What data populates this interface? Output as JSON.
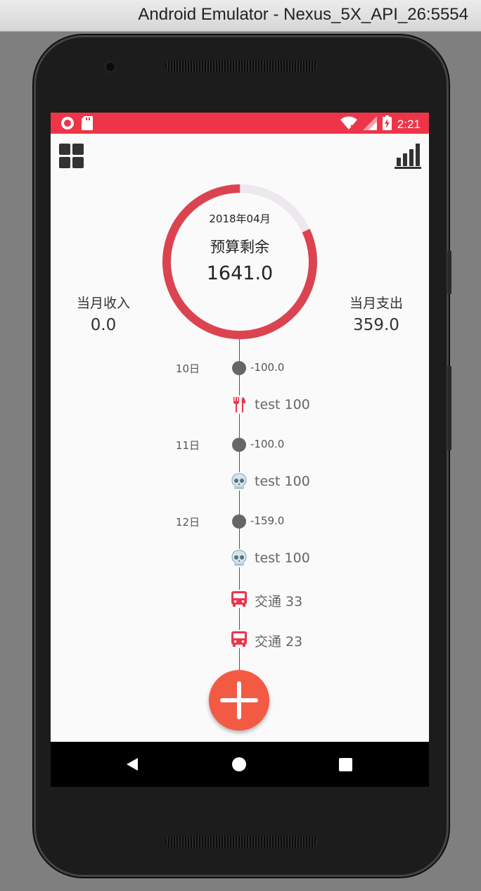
{
  "window": {
    "title": "Android Emulator - Nexus_5X_API_26:5554"
  },
  "status_bar": {
    "time": "2:21"
  },
  "app_bar": {
    "left_icon": "grid-icon",
    "right_icon": "bar-chart-icon"
  },
  "budget": {
    "month": "2018年04月",
    "label": "预算剩余",
    "value": "1641.0",
    "progress": 0.82
  },
  "income": {
    "label": "当月收入",
    "value": "0.0"
  },
  "expense": {
    "label": "当月支出",
    "value": "359.0"
  },
  "timeline": [
    {
      "type": "day",
      "day": "10日",
      "amount": "-100.0"
    },
    {
      "type": "item",
      "icon": "fork-knife-icon",
      "text": "test 100"
    },
    {
      "type": "day",
      "day": "11日",
      "amount": "-100.0"
    },
    {
      "type": "item",
      "icon": "skull-icon",
      "text": "test 100"
    },
    {
      "type": "day",
      "day": "12日",
      "amount": "-159.0"
    },
    {
      "type": "item",
      "icon": "skull-icon",
      "text": "test 100"
    },
    {
      "type": "item",
      "icon": "bus-icon",
      "text": "交通 33"
    },
    {
      "type": "item",
      "icon": "bus-icon",
      "text": "交通 23"
    }
  ],
  "colors": {
    "accent": "#ee3448",
    "ring": "#dc4350",
    "ring_track": "#ece8ee",
    "fab": "#f35a44"
  }
}
